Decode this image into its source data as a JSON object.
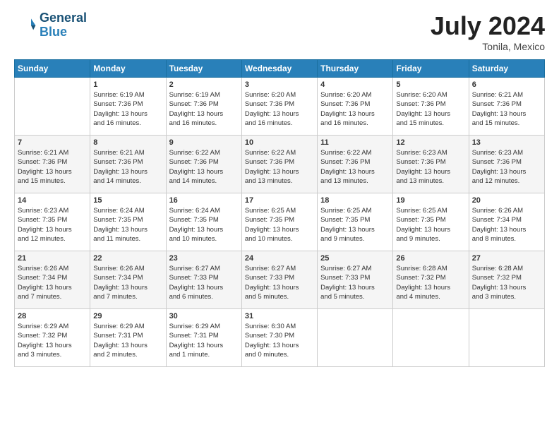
{
  "header": {
    "logo_line1": "General",
    "logo_line2": "Blue",
    "month_year": "July 2024",
    "location": "Tonila, Mexico"
  },
  "weekdays": [
    "Sunday",
    "Monday",
    "Tuesday",
    "Wednesday",
    "Thursday",
    "Friday",
    "Saturday"
  ],
  "weeks": [
    [
      {
        "day": "",
        "info": ""
      },
      {
        "day": "1",
        "info": "Sunrise: 6:19 AM\nSunset: 7:36 PM\nDaylight: 13 hours\nand 16 minutes."
      },
      {
        "day": "2",
        "info": "Sunrise: 6:19 AM\nSunset: 7:36 PM\nDaylight: 13 hours\nand 16 minutes."
      },
      {
        "day": "3",
        "info": "Sunrise: 6:20 AM\nSunset: 7:36 PM\nDaylight: 13 hours\nand 16 minutes."
      },
      {
        "day": "4",
        "info": "Sunrise: 6:20 AM\nSunset: 7:36 PM\nDaylight: 13 hours\nand 16 minutes."
      },
      {
        "day": "5",
        "info": "Sunrise: 6:20 AM\nSunset: 7:36 PM\nDaylight: 13 hours\nand 15 minutes."
      },
      {
        "day": "6",
        "info": "Sunrise: 6:21 AM\nSunset: 7:36 PM\nDaylight: 13 hours\nand 15 minutes."
      }
    ],
    [
      {
        "day": "7",
        "info": "Sunrise: 6:21 AM\nSunset: 7:36 PM\nDaylight: 13 hours\nand 15 minutes."
      },
      {
        "day": "8",
        "info": "Sunrise: 6:21 AM\nSunset: 7:36 PM\nDaylight: 13 hours\nand 14 minutes."
      },
      {
        "day": "9",
        "info": "Sunrise: 6:22 AM\nSunset: 7:36 PM\nDaylight: 13 hours\nand 14 minutes."
      },
      {
        "day": "10",
        "info": "Sunrise: 6:22 AM\nSunset: 7:36 PM\nDaylight: 13 hours\nand 13 minutes."
      },
      {
        "day": "11",
        "info": "Sunrise: 6:22 AM\nSunset: 7:36 PM\nDaylight: 13 hours\nand 13 minutes."
      },
      {
        "day": "12",
        "info": "Sunrise: 6:23 AM\nSunset: 7:36 PM\nDaylight: 13 hours\nand 13 minutes."
      },
      {
        "day": "13",
        "info": "Sunrise: 6:23 AM\nSunset: 7:36 PM\nDaylight: 13 hours\nand 12 minutes."
      }
    ],
    [
      {
        "day": "14",
        "info": "Sunrise: 6:23 AM\nSunset: 7:35 PM\nDaylight: 13 hours\nand 12 minutes."
      },
      {
        "day": "15",
        "info": "Sunrise: 6:24 AM\nSunset: 7:35 PM\nDaylight: 13 hours\nand 11 minutes."
      },
      {
        "day": "16",
        "info": "Sunrise: 6:24 AM\nSunset: 7:35 PM\nDaylight: 13 hours\nand 10 minutes."
      },
      {
        "day": "17",
        "info": "Sunrise: 6:25 AM\nSunset: 7:35 PM\nDaylight: 13 hours\nand 10 minutes."
      },
      {
        "day": "18",
        "info": "Sunrise: 6:25 AM\nSunset: 7:35 PM\nDaylight: 13 hours\nand 9 minutes."
      },
      {
        "day": "19",
        "info": "Sunrise: 6:25 AM\nSunset: 7:35 PM\nDaylight: 13 hours\nand 9 minutes."
      },
      {
        "day": "20",
        "info": "Sunrise: 6:26 AM\nSunset: 7:34 PM\nDaylight: 13 hours\nand 8 minutes."
      }
    ],
    [
      {
        "day": "21",
        "info": "Sunrise: 6:26 AM\nSunset: 7:34 PM\nDaylight: 13 hours\nand 7 minutes."
      },
      {
        "day": "22",
        "info": "Sunrise: 6:26 AM\nSunset: 7:34 PM\nDaylight: 13 hours\nand 7 minutes."
      },
      {
        "day": "23",
        "info": "Sunrise: 6:27 AM\nSunset: 7:33 PM\nDaylight: 13 hours\nand 6 minutes."
      },
      {
        "day": "24",
        "info": "Sunrise: 6:27 AM\nSunset: 7:33 PM\nDaylight: 13 hours\nand 5 minutes."
      },
      {
        "day": "25",
        "info": "Sunrise: 6:27 AM\nSunset: 7:33 PM\nDaylight: 13 hours\nand 5 minutes."
      },
      {
        "day": "26",
        "info": "Sunrise: 6:28 AM\nSunset: 7:32 PM\nDaylight: 13 hours\nand 4 minutes."
      },
      {
        "day": "27",
        "info": "Sunrise: 6:28 AM\nSunset: 7:32 PM\nDaylight: 13 hours\nand 3 minutes."
      }
    ],
    [
      {
        "day": "28",
        "info": "Sunrise: 6:29 AM\nSunset: 7:32 PM\nDaylight: 13 hours\nand 3 minutes."
      },
      {
        "day": "29",
        "info": "Sunrise: 6:29 AM\nSunset: 7:31 PM\nDaylight: 13 hours\nand 2 minutes."
      },
      {
        "day": "30",
        "info": "Sunrise: 6:29 AM\nSunset: 7:31 PM\nDaylight: 13 hours\nand 1 minute."
      },
      {
        "day": "31",
        "info": "Sunrise: 6:30 AM\nSunset: 7:30 PM\nDaylight: 13 hours\nand 0 minutes."
      },
      {
        "day": "",
        "info": ""
      },
      {
        "day": "",
        "info": ""
      },
      {
        "day": "",
        "info": ""
      }
    ]
  ]
}
